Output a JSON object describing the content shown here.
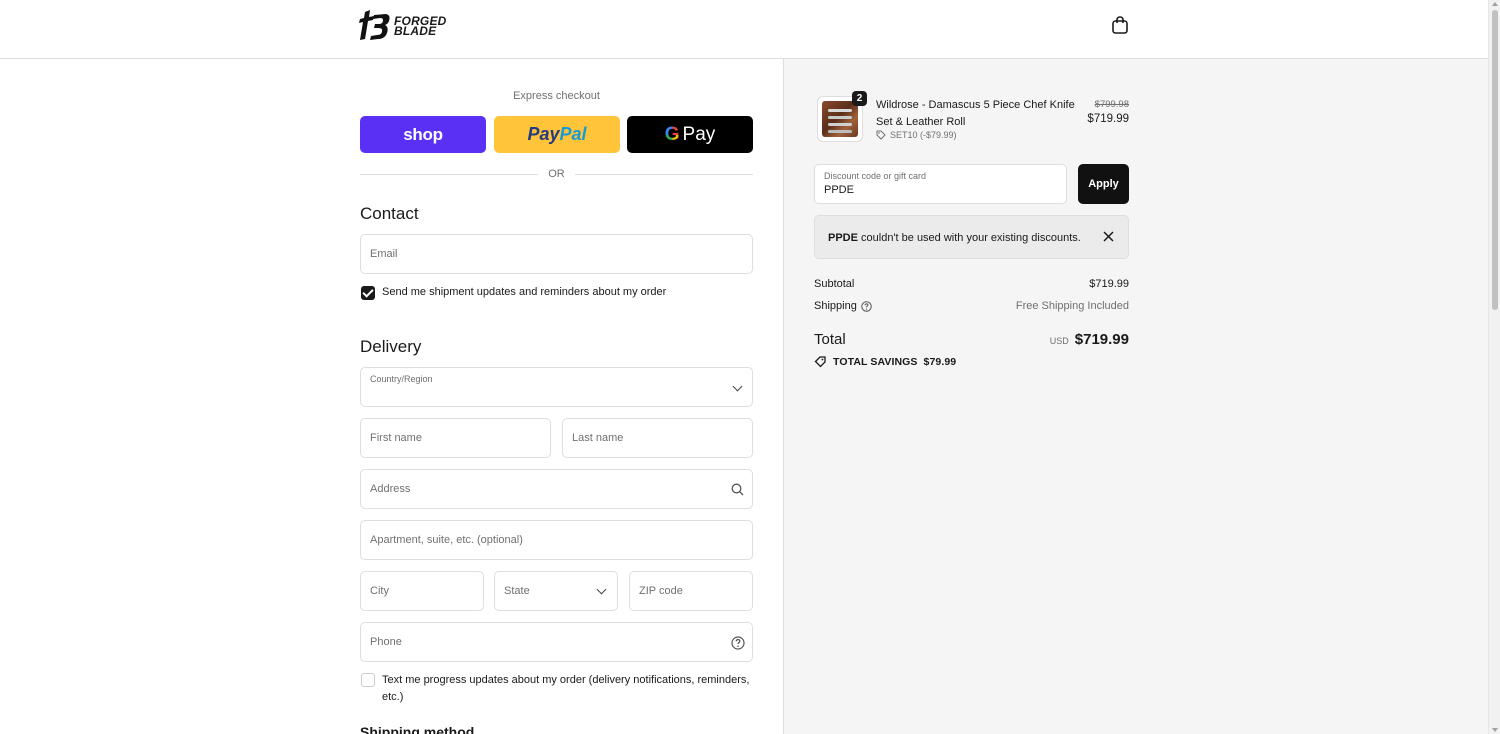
{
  "brand": {
    "line1": "FORGED",
    "line2": "BLADE"
  },
  "express": {
    "label": "Express checkout",
    "shop_label": "shop",
    "paypal_part1": "Pay",
    "paypal_part2": "Pal",
    "gpay_g": "G",
    "gpay_label": "Pay",
    "or_label": "OR"
  },
  "contact": {
    "title": "Contact",
    "email_placeholder": "Email",
    "updates_label": "Send me shipment updates and reminders about my order",
    "updates_checked": true
  },
  "delivery": {
    "title": "Delivery",
    "country_label": "Country/Region",
    "first_name_placeholder": "First name",
    "last_name_placeholder": "Last name",
    "address_placeholder": "Address",
    "apartment_placeholder": "Apartment, suite, etc. (optional)",
    "city_placeholder": "City",
    "state_placeholder": "State",
    "zip_placeholder": "ZIP code",
    "phone_placeholder": "Phone",
    "sms_label": "Text me progress updates about my order (delivery notifications, reminders, etc.)",
    "sms_checked": false
  },
  "shipping_method": {
    "title": "Shipping method"
  },
  "order": {
    "product_name": "Wildrose - Damascus 5 Piece Chef Knife Set & Leather Roll",
    "quantity": "2",
    "discount_tag": "SET10 (-$79.99)",
    "price_original": "$799.98",
    "price_final": "$719.99"
  },
  "discount": {
    "label": "Discount code or gift card",
    "value": "PPDE",
    "apply_label": "Apply",
    "error_code": "PPDE",
    "error_message": " couldn't be used with your existing discounts."
  },
  "summary": {
    "subtotal_label": "Subtotal",
    "subtotal_value": "$719.99",
    "shipping_label": "Shipping",
    "shipping_value": "Free Shipping Included",
    "total_label": "Total",
    "currency": "USD",
    "total_value": "$719.99",
    "savings_label": "TOTAL SAVINGS",
    "savings_value": "$79.99"
  },
  "colors": {
    "shop": "#5a31f4",
    "paypal": "#ffc439",
    "gpay": "#000000",
    "primary_button": "#111111"
  }
}
